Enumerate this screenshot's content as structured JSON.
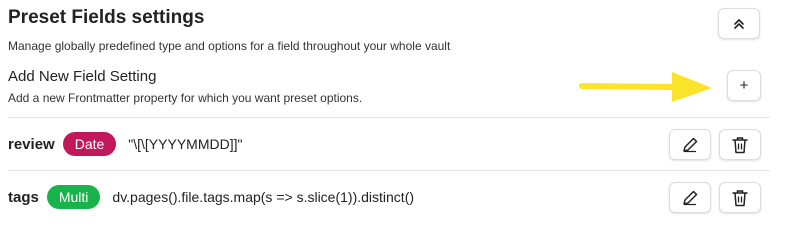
{
  "section": {
    "title": "Preset Fields settings",
    "description": "Manage globally predefined type and options for a field throughout your whole vault",
    "collapse_icon": "chevrons-up-icon"
  },
  "add_setting": {
    "title": "Add New Field Setting",
    "description": "Add a new Frontmatter property for which you want preset options.",
    "button_label": "+"
  },
  "fields": [
    {
      "name": "review",
      "type": "Date",
      "type_color": "#c2185b",
      "value": "\"\\[\\[YYYYMMDD]]\""
    },
    {
      "name": "tags",
      "type": "Multi",
      "type_color": "#18b34a",
      "value": "dv.pages().file.tags.map(s => s.slice(1)).distinct()"
    }
  ],
  "icons": {
    "edit": "pencil-icon",
    "delete": "trash-icon"
  },
  "annotation": {
    "arrow_color": "#fbe32a",
    "arrow_icon": "arrow-right-icon"
  }
}
